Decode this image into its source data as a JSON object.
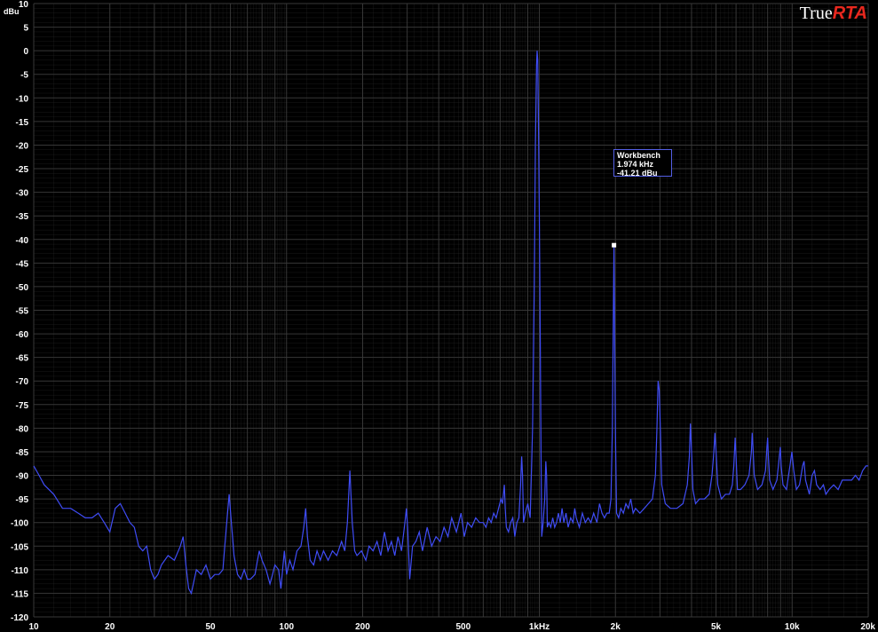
{
  "brand": {
    "part1": "True",
    "part2": "RTA"
  },
  "tooltip": {
    "name": "Workbench",
    "freq": "1.974 kHz",
    "level": "-41.21 dBu"
  },
  "colors": {
    "trace": "#3f4cf5",
    "grid": "#3a3a3a",
    "axis": "#ffffff",
    "brand_accent": "#e8281e"
  },
  "chart_data": {
    "type": "line",
    "x_scale": "log",
    "xlim": [
      10,
      20000
    ],
    "ylim": [
      -120,
      10
    ],
    "ylabel": "dBu",
    "grid": true,
    "y_ticks": [
      10,
      5,
      0,
      -5,
      -10,
      -15,
      -20,
      -25,
      -30,
      -35,
      -40,
      -45,
      -50,
      -55,
      -60,
      -65,
      -70,
      -75,
      -80,
      -85,
      -90,
      -95,
      -100,
      -105,
      -110,
      -115,
      -120
    ],
    "x_ticks": [
      {
        "value": 10,
        "label": "10"
      },
      {
        "value": 20,
        "label": "20"
      },
      {
        "value": 50,
        "label": "50"
      },
      {
        "value": 100,
        "label": "100"
      },
      {
        "value": 200,
        "label": "200"
      },
      {
        "value": 500,
        "label": "500"
      },
      {
        "value": 1000,
        "label": "1kHz"
      },
      {
        "value": 2000,
        "label": "2k"
      },
      {
        "value": 5000,
        "label": "5k"
      },
      {
        "value": 10000,
        "label": "10k"
      },
      {
        "value": 20000,
        "label": "20k"
      }
    ],
    "marker": {
      "x": 1974,
      "y": -41.21
    },
    "series": [
      {
        "points": [
          [
            10,
            -88
          ],
          [
            10.5,
            -90
          ],
          [
            11,
            -92
          ],
          [
            12,
            -94
          ],
          [
            13,
            -97
          ],
          [
            14,
            -97
          ],
          [
            15,
            -98
          ],
          [
            16,
            -99
          ],
          [
            17,
            -99
          ],
          [
            18,
            -98
          ],
          [
            19,
            -100
          ],
          [
            20,
            -102
          ],
          [
            21,
            -97
          ],
          [
            22,
            -96
          ],
          [
            23,
            -98
          ],
          [
            24,
            -100
          ],
          [
            25,
            -101
          ],
          [
            26,
            -105
          ],
          [
            27,
            -106
          ],
          [
            28,
            -105
          ],
          [
            29,
            -110
          ],
          [
            30,
            -112
          ],
          [
            31,
            -111
          ],
          [
            32,
            -109
          ],
          [
            34,
            -107
          ],
          [
            36,
            -108
          ],
          [
            38,
            -105
          ],
          [
            39,
            -103
          ],
          [
            40,
            -109
          ],
          [
            41,
            -114
          ],
          [
            42,
            -115
          ],
          [
            44,
            -110
          ],
          [
            46,
            -111
          ],
          [
            48,
            -109
          ],
          [
            50,
            -112
          ],
          [
            52,
            -111
          ],
          [
            54,
            -111
          ],
          [
            56,
            -110
          ],
          [
            57,
            -105
          ],
          [
            58,
            -100
          ],
          [
            59.3,
            -94
          ],
          [
            60.5,
            -100
          ],
          [
            62,
            -107
          ],
          [
            64,
            -111
          ],
          [
            66,
            -112
          ],
          [
            68,
            -110
          ],
          [
            70,
            -112
          ],
          [
            72,
            -112
          ],
          [
            75,
            -111
          ],
          [
            78,
            -106
          ],
          [
            80,
            -108
          ],
          [
            83,
            -110
          ],
          [
            86,
            -113
          ],
          [
            88,
            -111
          ],
          [
            90,
            -109
          ],
          [
            93,
            -110
          ],
          [
            95,
            -114
          ],
          [
            98,
            -106
          ],
          [
            100,
            -111
          ],
          [
            103,
            -108
          ],
          [
            106,
            -110
          ],
          [
            110,
            -106
          ],
          [
            114,
            -105
          ],
          [
            117,
            -101
          ],
          [
            119,
            -97
          ],
          [
            121,
            -103
          ],
          [
            124,
            -108
          ],
          [
            128,
            -109
          ],
          [
            132,
            -106
          ],
          [
            136,
            -108
          ],
          [
            140,
            -106
          ],
          [
            146,
            -108
          ],
          [
            152,
            -106
          ],
          [
            158,
            -107
          ],
          [
            165,
            -104
          ],
          [
            170,
            -106
          ],
          [
            174,
            -100
          ],
          [
            178,
            -89
          ],
          [
            182,
            -100
          ],
          [
            186,
            -106
          ],
          [
            190,
            -107
          ],
          [
            198,
            -106
          ],
          [
            206,
            -108
          ],
          [
            212,
            -105
          ],
          [
            220,
            -106
          ],
          [
            228,
            -104
          ],
          [
            236,
            -107
          ],
          [
            244,
            -102
          ],
          [
            252,
            -106
          ],
          [
            260,
            -104
          ],
          [
            268,
            -107
          ],
          [
            276,
            -103
          ],
          [
            285,
            -106
          ],
          [
            294,
            -100
          ],
          [
            298,
            -97
          ],
          [
            302,
            -102
          ],
          [
            307,
            -112
          ],
          [
            315,
            -105
          ],
          [
            325,
            -104
          ],
          [
            335,
            -102
          ],
          [
            345,
            -106
          ],
          [
            360,
            -101
          ],
          [
            375,
            -105
          ],
          [
            390,
            -103
          ],
          [
            405,
            -104
          ],
          [
            420,
            -101
          ],
          [
            435,
            -103
          ],
          [
            450,
            -99
          ],
          [
            470,
            -102
          ],
          [
            490,
            -98
          ],
          [
            505,
            -103
          ],
          [
            520,
            -100
          ],
          [
            540,
            -101
          ],
          [
            560,
            -99
          ],
          [
            580,
            -100
          ],
          [
            600,
            -100
          ],
          [
            615,
            -101
          ],
          [
            630,
            -99
          ],
          [
            645,
            -100
          ],
          [
            660,
            -98
          ],
          [
            675,
            -99
          ],
          [
            690,
            -97
          ],
          [
            705,
            -95
          ],
          [
            715,
            -96
          ],
          [
            727,
            -92
          ],
          [
            733,
            -97
          ],
          [
            741,
            -101
          ],
          [
            755,
            -102
          ],
          [
            770,
            -100
          ],
          [
            785,
            -99
          ],
          [
            800,
            -103
          ],
          [
            815,
            -100
          ],
          [
            830,
            -99
          ],
          [
            843,
            -92
          ],
          [
            851,
            -86
          ],
          [
            858,
            -90
          ],
          [
            866,
            -100
          ],
          [
            880,
            -98
          ],
          [
            900,
            -96
          ],
          [
            920,
            -99
          ],
          [
            940,
            -80
          ],
          [
            955,
            -50
          ],
          [
            965,
            -20
          ],
          [
            975,
            -3
          ],
          [
            980,
            0
          ],
          [
            985,
            -2
          ],
          [
            992,
            -15
          ],
          [
            1000,
            -35
          ],
          [
            1008,
            -60
          ],
          [
            1015,
            -85
          ],
          [
            1022,
            -103
          ],
          [
            1035,
            -100
          ],
          [
            1050,
            -95
          ],
          [
            1061,
            -87
          ],
          [
            1068,
            -90
          ],
          [
            1075,
            -101
          ],
          [
            1090,
            -100
          ],
          [
            1110,
            -101
          ],
          [
            1130,
            -99
          ],
          [
            1150,
            -101
          ],
          [
            1170,
            -100
          ],
          [
            1190,
            -98
          ],
          [
            1210,
            -100
          ],
          [
            1230,
            -97
          ],
          [
            1250,
            -100
          ],
          [
            1275,
            -98
          ],
          [
            1300,
            -101
          ],
          [
            1330,
            -99
          ],
          [
            1360,
            -100
          ],
          [
            1380,
            -97
          ],
          [
            1400,
            -99
          ],
          [
            1440,
            -101
          ],
          [
            1480,
            -98
          ],
          [
            1520,
            -100
          ],
          [
            1560,
            -99
          ],
          [
            1600,
            -100
          ],
          [
            1640,
            -98
          ],
          [
            1690,
            -100
          ],
          [
            1730,
            -96
          ],
          [
            1770,
            -98
          ],
          [
            1810,
            -99
          ],
          [
            1850,
            -98
          ],
          [
            1890,
            -98
          ],
          [
            1920,
            -95
          ],
          [
            1945,
            -80
          ],
          [
            1960,
            -60
          ],
          [
            1974,
            -41.2
          ],
          [
            1985,
            -60
          ],
          [
            2000,
            -80
          ],
          [
            2020,
            -98
          ],
          [
            2060,
            -99
          ],
          [
            2100,
            -97
          ],
          [
            2150,
            -98
          ],
          [
            2200,
            -96
          ],
          [
            2250,
            -97
          ],
          [
            2300,
            -95
          ],
          [
            2350,
            -98
          ],
          [
            2400,
            -97
          ],
          [
            2500,
            -98
          ],
          [
            2600,
            -97
          ],
          [
            2700,
            -96
          ],
          [
            2800,
            -95
          ],
          [
            2880,
            -90
          ],
          [
            2920,
            -80
          ],
          [
            2950,
            -70
          ],
          [
            2980,
            -72
          ],
          [
            3010,
            -80
          ],
          [
            3050,
            -92
          ],
          [
            3150,
            -96
          ],
          [
            3300,
            -97
          ],
          [
            3500,
            -97
          ],
          [
            3700,
            -96
          ],
          [
            3850,
            -92
          ],
          [
            3920,
            -86
          ],
          [
            3960,
            -79
          ],
          [
            4000,
            -85
          ],
          [
            4050,
            -93
          ],
          [
            4150,
            -96
          ],
          [
            4300,
            -95
          ],
          [
            4500,
            -95
          ],
          [
            4700,
            -94
          ],
          [
            4820,
            -90
          ],
          [
            4900,
            -85
          ],
          [
            4950,
            -81
          ],
          [
            5000,
            -85
          ],
          [
            5080,
            -92
          ],
          [
            5250,
            -95
          ],
          [
            5450,
            -94
          ],
          [
            5650,
            -94
          ],
          [
            5800,
            -92
          ],
          [
            5880,
            -88
          ],
          [
            5950,
            -82
          ],
          [
            6000,
            -86
          ],
          [
            6080,
            -93
          ],
          [
            6250,
            -93
          ],
          [
            6500,
            -92
          ],
          [
            6750,
            -90
          ],
          [
            6900,
            -85
          ],
          [
            6950,
            -81
          ],
          [
            7000,
            -84
          ],
          [
            7080,
            -90
          ],
          [
            7300,
            -93
          ],
          [
            7600,
            -92
          ],
          [
            7850,
            -89
          ],
          [
            7950,
            -84
          ],
          [
            8000,
            -82
          ],
          [
            8050,
            -86
          ],
          [
            8150,
            -91
          ],
          [
            8400,
            -93
          ],
          [
            8700,
            -91
          ],
          [
            8900,
            -86
          ],
          [
            8980,
            -84
          ],
          [
            9050,
            -88
          ],
          [
            9200,
            -92
          ],
          [
            9500,
            -93
          ],
          [
            9800,
            -88
          ],
          [
            9980,
            -85
          ],
          [
            10150,
            -89
          ],
          [
            10400,
            -93
          ],
          [
            10700,
            -92
          ],
          [
            11000,
            -88
          ],
          [
            11150,
            -87
          ],
          [
            11300,
            -91
          ],
          [
            11700,
            -94
          ],
          [
            12000,
            -90
          ],
          [
            12250,
            -89
          ],
          [
            12500,
            -92
          ],
          [
            12900,
            -93
          ],
          [
            13300,
            -92
          ],
          [
            13600,
            -94
          ],
          [
            14000,
            -93
          ],
          [
            14600,
            -92
          ],
          [
            15200,
            -93
          ],
          [
            15800,
            -91
          ],
          [
            16500,
            -91
          ],
          [
            17200,
            -91
          ],
          [
            17800,
            -90
          ],
          [
            18400,
            -91
          ],
          [
            19000,
            -89
          ],
          [
            19600,
            -88
          ],
          [
            20000,
            -88
          ]
        ]
      }
    ]
  }
}
